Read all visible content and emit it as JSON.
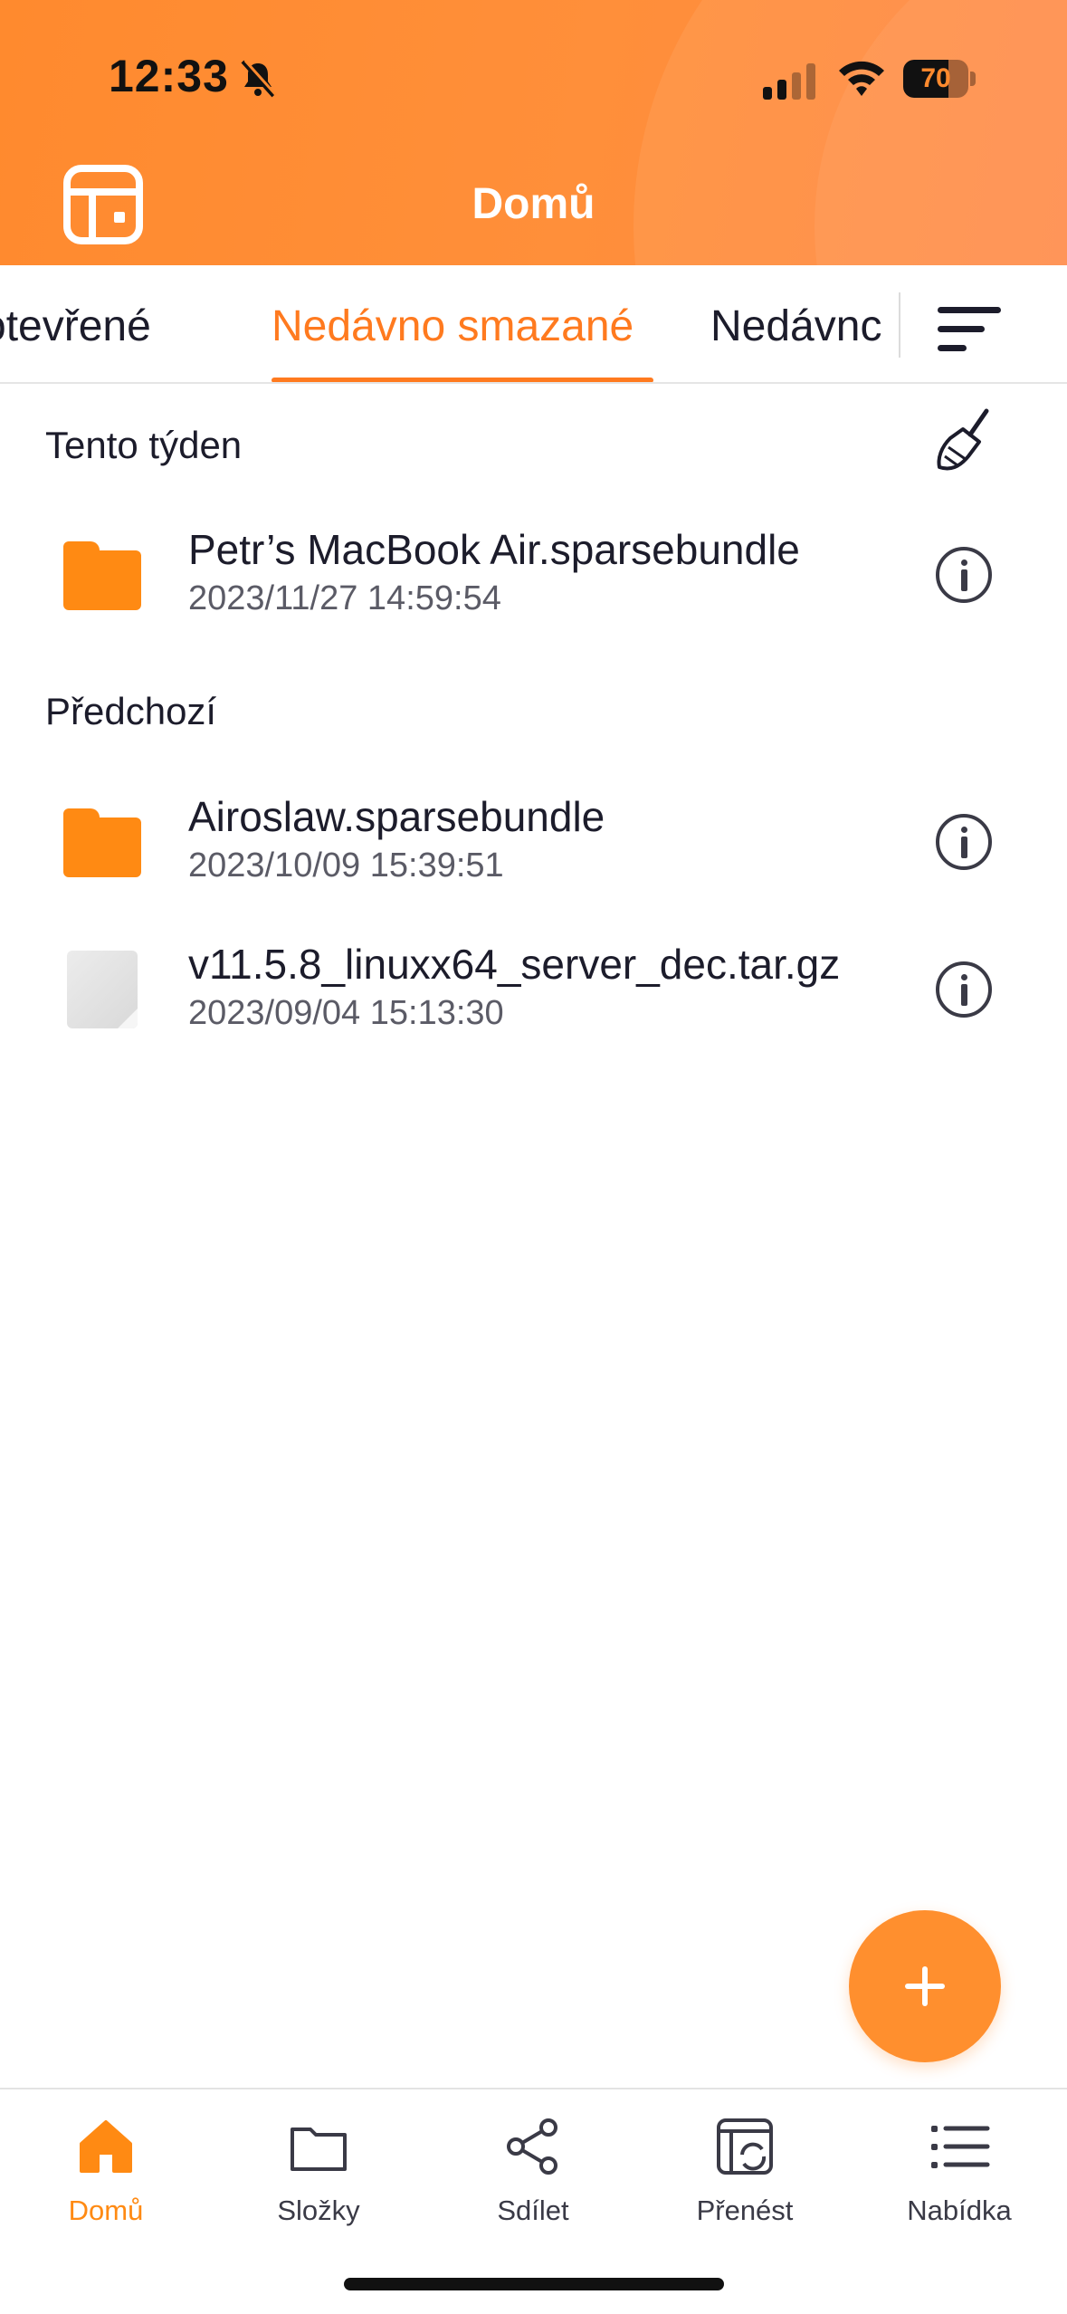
{
  "status_bar": {
    "time": "12:33",
    "battery": "70",
    "battery_level": 0.7
  },
  "header": {
    "title": "Domů"
  },
  "tabs": {
    "items": [
      "Otevřené",
      "Nedávno smazané",
      "Nedávno"
    ],
    "active": "Nedávno smazané",
    "open_visible": "otevřené",
    "recent_visible": "Nedávnc"
  },
  "sections": {
    "this_week": {
      "title": "Tento týden",
      "items": [
        {
          "name": "Petr’s MacBook Air.sparsebundle",
          "date": "2023/11/27 14:59:54",
          "icon": "folder-icon"
        }
      ]
    },
    "previous": {
      "title": "Předchozí",
      "items": [
        {
          "name": "Airoslaw.sparsebundle",
          "date": "2023/10/09 15:39:51",
          "icon": "folder-icon"
        },
        {
          "name": "v11.5.8_linuxx64_server_dec.tar.gz",
          "date": "2023/09/04 15:13:30",
          "icon": "file-icon"
        }
      ]
    }
  },
  "bottom_nav": {
    "items": [
      {
        "label": "Domů",
        "icon": "home-icon"
      },
      {
        "label": "Složky",
        "icon": "folder-outline-icon"
      },
      {
        "label": "Sdílet",
        "icon": "share-icon"
      },
      {
        "label": "Přenést",
        "icon": "transfer-icon"
      },
      {
        "label": "Nabídka",
        "icon": "menu-list-icon"
      }
    ],
    "active": "Domů"
  },
  "colors": {
    "accent": "#ff8a13",
    "header": "#ff8a2e",
    "text": "#1c1c2b"
  }
}
